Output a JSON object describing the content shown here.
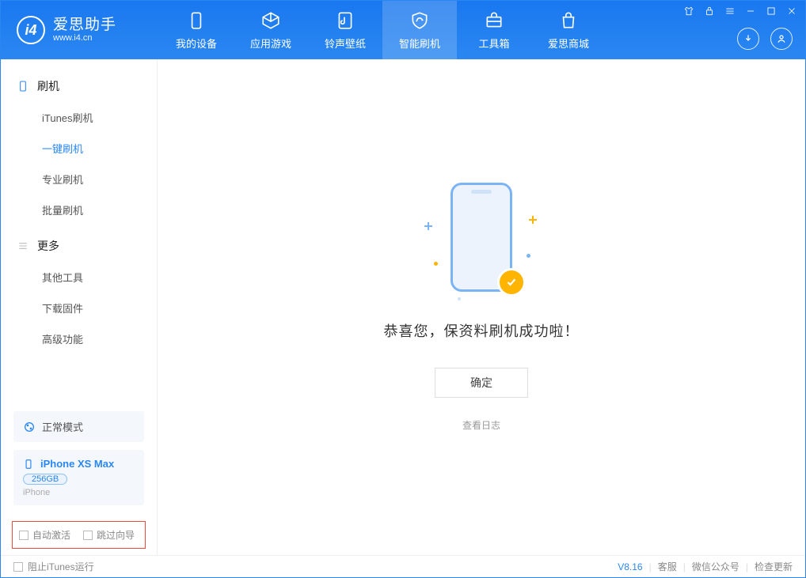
{
  "app": {
    "title": "爱思助手",
    "subtitle": "www.i4.cn"
  },
  "nav": {
    "tabs": [
      {
        "label": "我的设备"
      },
      {
        "label": "应用游戏"
      },
      {
        "label": "铃声壁纸"
      },
      {
        "label": "智能刷机"
      },
      {
        "label": "工具箱"
      },
      {
        "label": "爱思商城"
      }
    ]
  },
  "sidebar": {
    "section1": {
      "title": "刷机",
      "items": [
        "iTunes刷机",
        "一键刷机",
        "专业刷机",
        "批量刷机"
      ]
    },
    "section2": {
      "title": "更多",
      "items": [
        "其他工具",
        "下载固件",
        "高级功能"
      ]
    },
    "mode_card": "正常模式",
    "device": {
      "name": "iPhone XS Max",
      "capacity": "256GB",
      "type": "iPhone"
    },
    "checks": {
      "auto_activate": "自动激活",
      "skip_guide": "跳过向导"
    }
  },
  "main": {
    "success": "恭喜您，保资料刷机成功啦！",
    "ok": "确定",
    "view_log": "查看日志"
  },
  "footer": {
    "block_itunes": "阻止iTunes运行",
    "version": "V8.16",
    "links": [
      "客服",
      "微信公众号",
      "检查更新"
    ]
  }
}
